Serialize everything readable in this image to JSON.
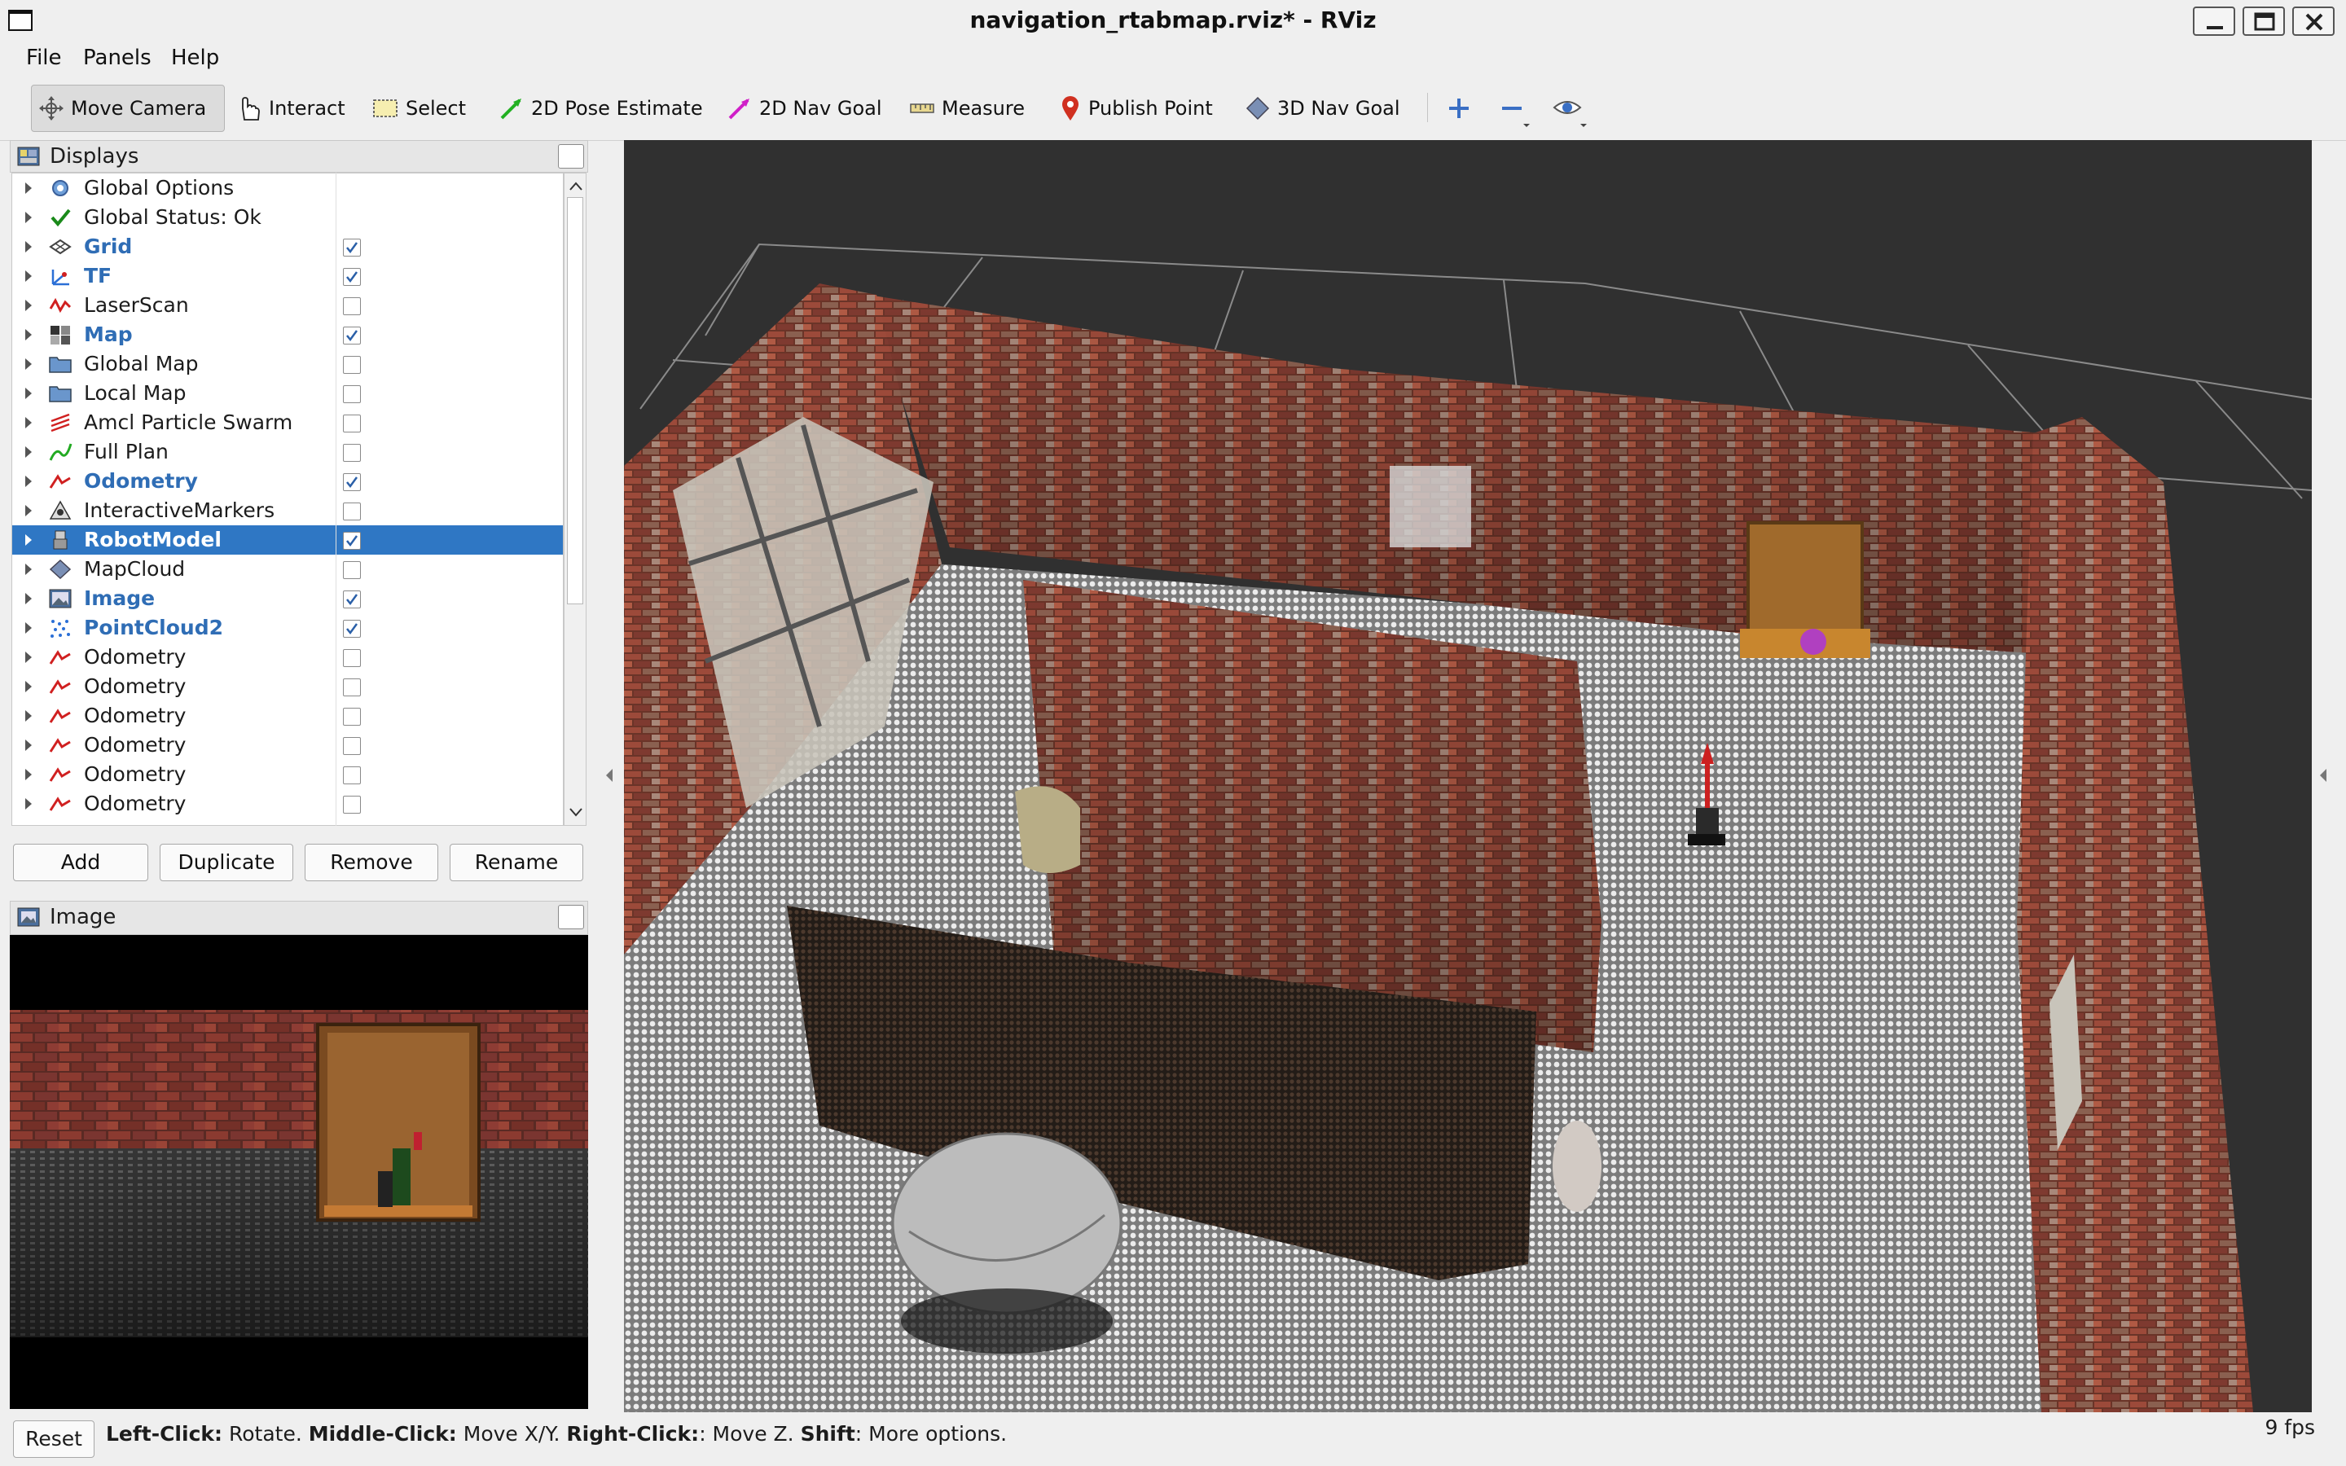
{
  "window": {
    "title": "navigation_rtabmap.rviz* - RViz"
  },
  "menu": [
    "File",
    "Panels",
    "Help"
  ],
  "toolbar": {
    "tools": [
      {
        "label": "Move Camera",
        "icon": "move-camera-icon",
        "active": true
      },
      {
        "label": "Interact",
        "icon": "interact-icon"
      },
      {
        "label": "Select",
        "icon": "select-icon"
      },
      {
        "label": "2D Pose Estimate",
        "icon": "pose-estimate-icon",
        "color": "#22b022"
      },
      {
        "label": "2D Nav Goal",
        "icon": "nav-goal-icon",
        "color": "#d020c8"
      },
      {
        "label": "Measure",
        "icon": "measure-icon"
      },
      {
        "label": "Publish Point",
        "icon": "publish-point-icon",
        "color": "#d03020"
      },
      {
        "label": "3D Nav Goal",
        "icon": "3d-nav-goal-icon"
      }
    ]
  },
  "displays": {
    "title": "Displays",
    "items": [
      {
        "label": "Global Options",
        "bold": false,
        "checked": null,
        "icon": "gear-icon"
      },
      {
        "label": "Global Status: Ok",
        "bold": false,
        "checked": null,
        "icon": "checkmark-icon"
      },
      {
        "label": "Grid",
        "bold": true,
        "checked": true,
        "icon": "grid-icon"
      },
      {
        "label": "TF",
        "bold": true,
        "checked": true,
        "icon": "tf-icon"
      },
      {
        "label": "LaserScan",
        "bold": false,
        "checked": false,
        "icon": "laserscan-icon"
      },
      {
        "label": "Map",
        "bold": true,
        "checked": true,
        "icon": "map-icon"
      },
      {
        "label": "Global Map",
        "bold": false,
        "checked": false,
        "icon": "folder-icon"
      },
      {
        "label": "Local Map",
        "bold": false,
        "checked": false,
        "icon": "folder-icon"
      },
      {
        "label": "Amcl Particle Swarm",
        "bold": false,
        "checked": false,
        "icon": "particle-swarm-icon"
      },
      {
        "label": "Full Plan",
        "bold": false,
        "checked": false,
        "icon": "path-icon"
      },
      {
        "label": "Odometry",
        "bold": true,
        "checked": true,
        "icon": "odometry-icon"
      },
      {
        "label": "InteractiveMarkers",
        "bold": false,
        "checked": false,
        "icon": "interactive-markers-icon"
      },
      {
        "label": "RobotModel",
        "bold": true,
        "checked": true,
        "icon": "robot-model-icon",
        "selected": true
      },
      {
        "label": "MapCloud",
        "bold": false,
        "checked": false,
        "icon": "mapcloud-icon"
      },
      {
        "label": "Image",
        "bold": true,
        "checked": true,
        "icon": "image-icon"
      },
      {
        "label": "PointCloud2",
        "bold": true,
        "checked": true,
        "icon": "pointcloud-icon"
      },
      {
        "label": "Odometry",
        "bold": false,
        "checked": false,
        "icon": "odometry-icon"
      },
      {
        "label": "Odometry",
        "bold": false,
        "checked": false,
        "icon": "odometry-icon"
      },
      {
        "label": "Odometry",
        "bold": false,
        "checked": false,
        "icon": "odometry-icon"
      },
      {
        "label": "Odometry",
        "bold": false,
        "checked": false,
        "icon": "odometry-icon"
      },
      {
        "label": "Odometry",
        "bold": false,
        "checked": false,
        "icon": "odometry-icon"
      },
      {
        "label": "Odometry",
        "bold": false,
        "checked": false,
        "icon": "odometry-icon"
      }
    ],
    "buttons": [
      "Add",
      "Duplicate",
      "Remove",
      "Rename"
    ]
  },
  "image_panel": {
    "title": "Image"
  },
  "status": {
    "reset_label": "Reset",
    "hint_parts": [
      {
        "text": "Left-Click:",
        "bold": true
      },
      {
        "text": " Rotate. ",
        "bold": false
      },
      {
        "text": "Middle-Click:",
        "bold": true
      },
      {
        "text": " Move X/Y. ",
        "bold": false
      },
      {
        "text": "Right-Click:",
        "bold": true
      },
      {
        "text": ": Move Z. ",
        "bold": false
      },
      {
        "text": "Shift",
        "bold": true
      },
      {
        "text": ": More options.",
        "bold": false
      }
    ],
    "fps": "9 fps"
  },
  "colors": {
    "selection": "#2f77c4",
    "bold_item": "#2f6db5",
    "viewport_bg": "#303030"
  }
}
